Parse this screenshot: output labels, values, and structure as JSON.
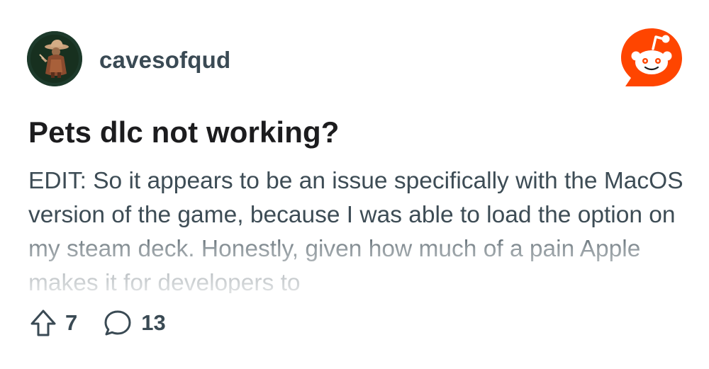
{
  "post": {
    "subreddit": "cavesofqud",
    "title": "Pets dlc not working?",
    "body": "EDIT: So it appears to be an issue specifically with the MacOS version of the game, because I was able to load the option on my steam deck. Honestly, given how much of a pain Apple makes it for developers to",
    "upvotes": "7",
    "comments": "13"
  },
  "icons": {
    "avatar": "subreddit-avatar",
    "logo": "reddit-logo-icon",
    "upvote": "upvote-arrow-icon",
    "comment": "comment-bubble-icon"
  },
  "colors": {
    "reddit_orange": "#ff4500",
    "text_secondary": "#3a4a54"
  }
}
